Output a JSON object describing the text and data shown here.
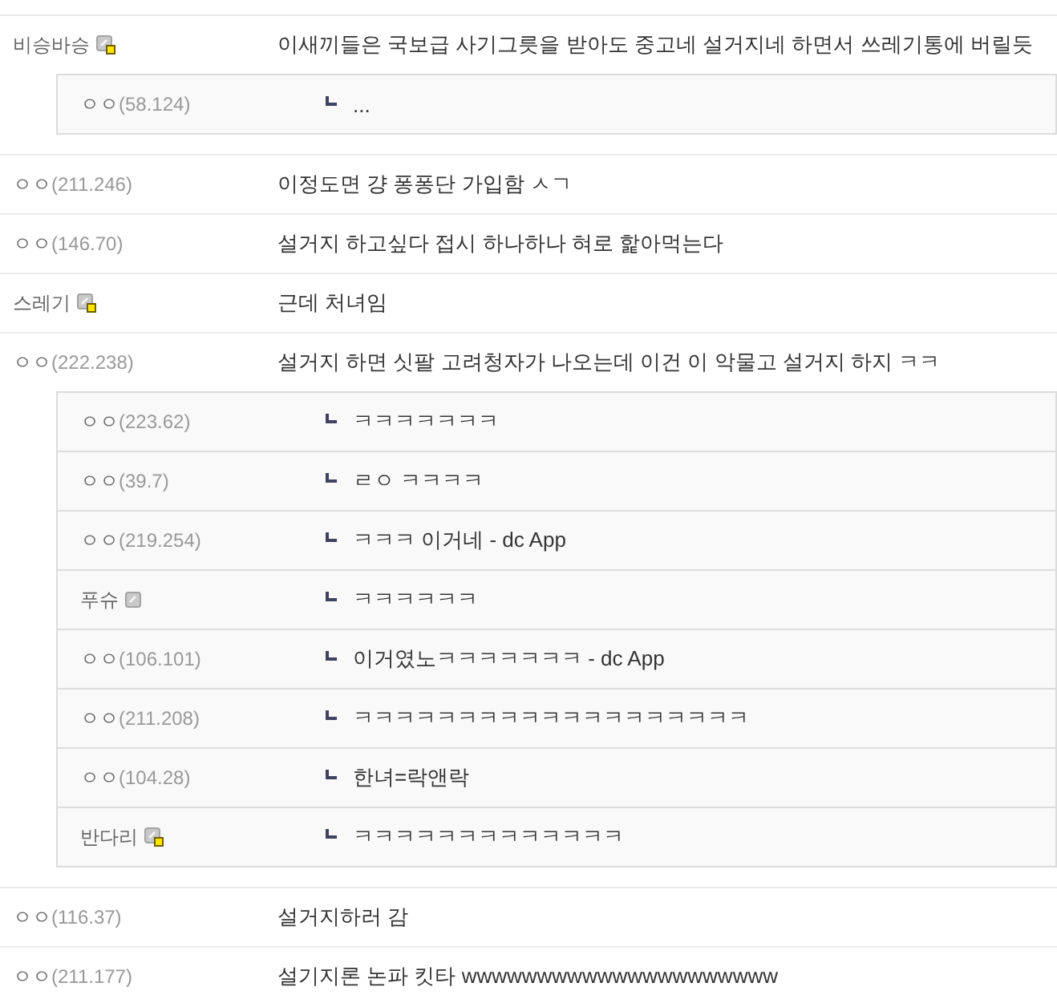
{
  "comments": [
    {
      "nick": "비승바승",
      "kind": "fixed",
      "text": "이새끼들은 국보급 사기그릇을 받아도 중고네 설거지네 하면서 쓰레기통에 버릴듯",
      "replies": [
        {
          "nick": "ㅇㅇ",
          "ip": "(58.124)",
          "kind": "guest",
          "text": "..."
        }
      ]
    },
    {
      "nick": "ㅇㅇ",
      "ip": "(211.246)",
      "kind": "guest",
      "text": "이정도면 걍 퐁퐁단 가입함 ㅅㄱ"
    },
    {
      "nick": "ㅇㅇ",
      "ip": "(146.70)",
      "kind": "guest",
      "text": "설거지 하고싶다 접시 하나하나 혀로 핥아먹는다"
    },
    {
      "nick": "스레기",
      "kind": "fixed",
      "text": "근데 처녀임"
    },
    {
      "nick": "ㅇㅇ",
      "ip": "(222.238)",
      "kind": "guest",
      "text": "설거지 하면 싯팔 고려청자가 나오는데 이건 이 악물고 설거지 하지 ㅋㅋ",
      "replies": [
        {
          "nick": "ㅇㅇ",
          "ip": "(223.62)",
          "kind": "guest",
          "text": "ㅋㅋㅋㅋㅋㅋㅋ"
        },
        {
          "nick": "ㅇㅇ",
          "ip": "(39.7)",
          "kind": "guest",
          "text": "ㄹㅇ ㅋㅋㅋㅋ"
        },
        {
          "nick": "ㅇㅇ",
          "ip": "(219.254)",
          "kind": "guest",
          "text": "ㅋㅋㅋ 이거네 - dc App"
        },
        {
          "nick": "푸슈",
          "kind": "semifixed",
          "text": "ㅋㅋㅋㅋㅋㅋ"
        },
        {
          "nick": "ㅇㅇ",
          "ip": "(106.101)",
          "kind": "guest",
          "text": "이거였노ㅋㅋㅋㅋㅋㅋㅋ - dc App"
        },
        {
          "nick": "ㅇㅇ",
          "ip": "(211.208)",
          "kind": "guest",
          "text": "ㅋㅋㅋㅋㅋㅋㅋㅋㅋㅋㅋㅋㅋㅋㅋㅋㅋㅋㅋ"
        },
        {
          "nick": "ㅇㅇ",
          "ip": "(104.28)",
          "kind": "guest",
          "text": "한녀=락앤락"
        },
        {
          "nick": "반다리",
          "kind": "fixed",
          "text": "ㅋㅋㅋㅋㅋㅋㅋㅋㅋㅋㅋㅋㅋ"
        }
      ]
    },
    {
      "nick": "ㅇㅇ",
      "ip": "(116.37)",
      "kind": "guest",
      "text": "설거지하러 감"
    },
    {
      "nick": "ㅇㅇ",
      "ip": "(211.177)",
      "kind": "guest",
      "text": "설기지론 논파 킷타 wwwwwwwwwwwwwwwwwwwww"
    }
  ]
}
